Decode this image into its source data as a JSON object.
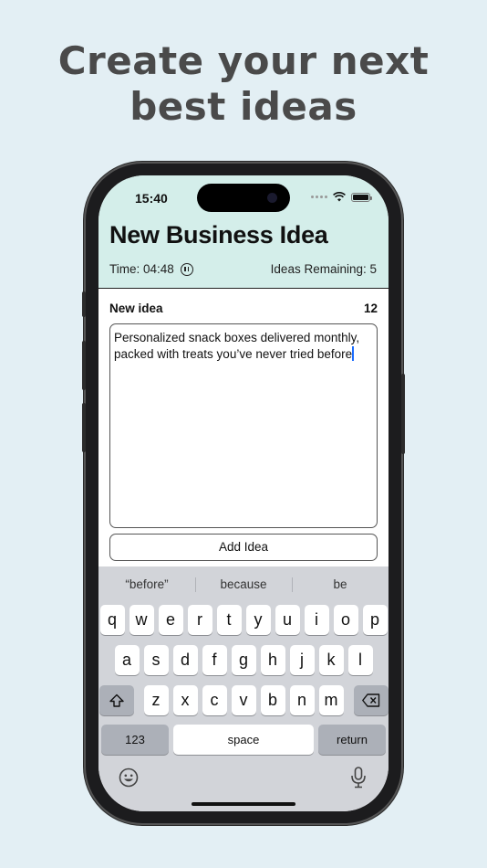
{
  "headline": {
    "line1": "Create your next",
    "line2": "best ideas"
  },
  "status_bar": {
    "time": "15:40"
  },
  "header": {
    "title": "New Business Idea",
    "timer": "Time: 04:48",
    "ideas_remaining": "Ideas Remaining: 5",
    "accent_color": "#d4eeea"
  },
  "form": {
    "label": "New idea",
    "counter": "12",
    "text": "Personalized snack boxes delivered monthly, packed with treats you’ve never tried before",
    "add_button": "Add Idea"
  },
  "keyboard": {
    "suggestions": [
      "“before”",
      "because",
      "be"
    ],
    "row1": [
      "q",
      "w",
      "e",
      "r",
      "t",
      "y",
      "u",
      "i",
      "o",
      "p"
    ],
    "row2": [
      "a",
      "s",
      "d",
      "f",
      "g",
      "h",
      "j",
      "k",
      "l"
    ],
    "row3": [
      "z",
      "x",
      "c",
      "v",
      "b",
      "n",
      "m"
    ],
    "numbers_label": "123",
    "space_label": "space",
    "return_label": "return"
  },
  "icons": [
    "pause-icon",
    "wifi-icon",
    "battery-icon",
    "shift-icon",
    "delete-icon",
    "emoji-icon",
    "microphone-icon"
  ]
}
